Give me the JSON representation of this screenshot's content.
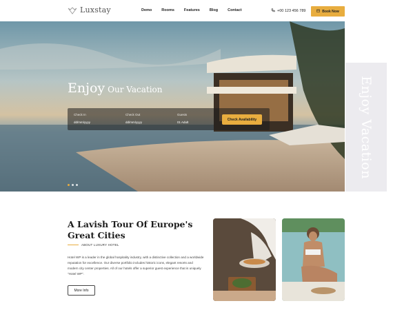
{
  "brand": {
    "name": "Luxstay"
  },
  "nav": {
    "items": [
      "Demo",
      "Rooms",
      "Features",
      "Blog",
      "Contact"
    ]
  },
  "header": {
    "phone": "+00 123 456 789",
    "book_label": "Book Now"
  },
  "hero": {
    "title_big": "Enjoy",
    "title_small": "Our Vacation",
    "booking": {
      "checkin_label": "Check In",
      "checkin_value": "dd/mm/yyyy",
      "checkout_label": "Check Out",
      "checkout_value": "dd/mm/yyyy",
      "guests_label": "Guests",
      "guests_value": "01 Adult",
      "button": "Check Availability"
    },
    "slides": {
      "count": 3,
      "active": 0
    },
    "side_text": "Enjoy Vacation"
  },
  "about": {
    "title": "A Lavish Tour Of Europe's Great Cities",
    "subtitle": "ABOUT LUXURY HOTEL",
    "body": "Hotel WP is a leader in the global hospitality industry, with a distinctive collection and a worldwide reputation for excellence. Our diverse portfolio includes historic icons, elegant resorts and modern city center properties. All of our hotels offer a superior guest experience that is uniquely \"Hotel WP\".",
    "button": "More Info"
  },
  "colors": {
    "accent": "#e8ad3f",
    "side_panel": "#ecebef"
  }
}
